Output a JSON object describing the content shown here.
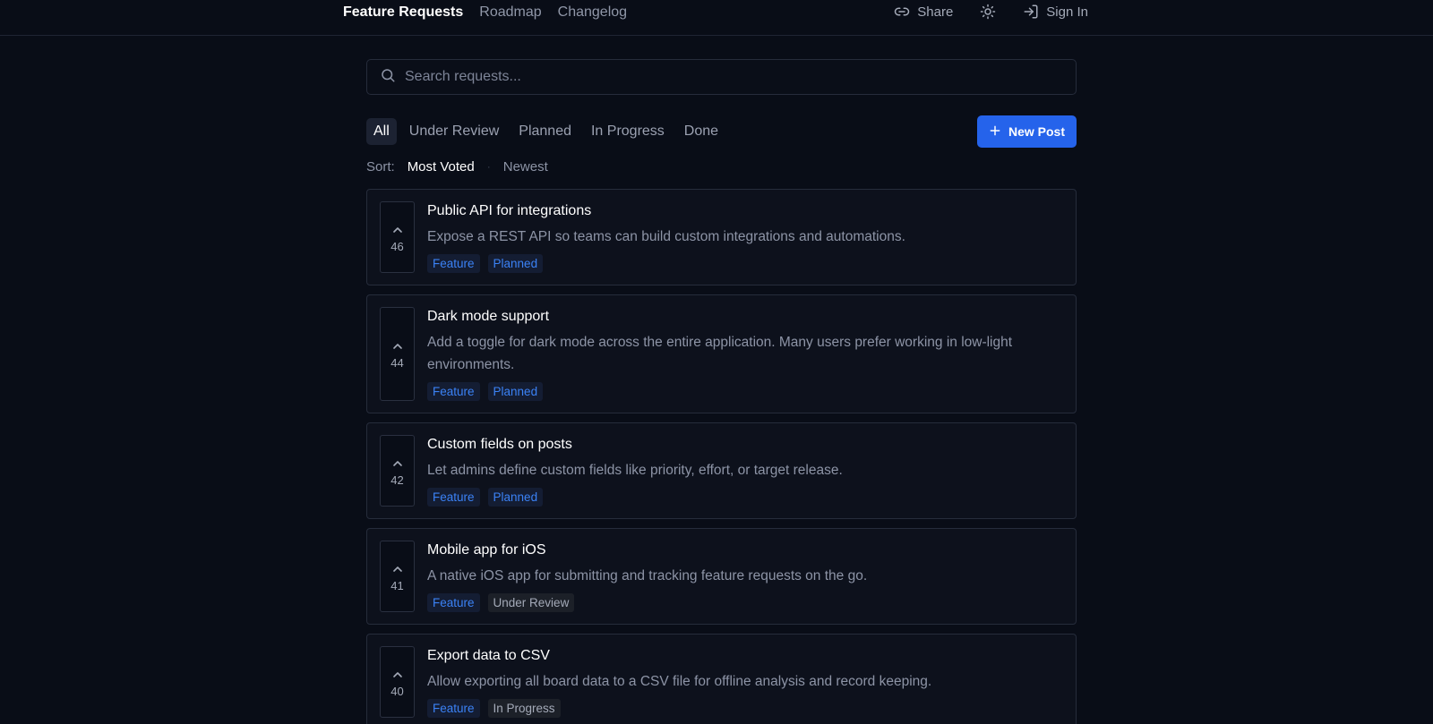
{
  "nav": {
    "links": [
      "Feature Requests",
      "Roadmap",
      "Changelog"
    ],
    "share_label": "Share",
    "signin_label": "Sign In"
  },
  "search": {
    "placeholder": "Search requests..."
  },
  "filters": [
    "All",
    "Under Review",
    "Planned",
    "In Progress",
    "Done"
  ],
  "new_post_label": "New Post",
  "sort": {
    "label": "Sort:",
    "options": [
      "Most Voted",
      "Newest"
    ],
    "separator": "·"
  },
  "posts": [
    {
      "title": "Public API for integrations",
      "description": "Expose a REST API so teams can build custom integrations and automations.",
      "votes": "46",
      "tags": [
        "Feature",
        "Planned"
      ]
    },
    {
      "title": "Dark mode support",
      "description": "Add a toggle for dark mode across the entire application. Many users prefer working in low-light environments.",
      "votes": "44",
      "tags": [
        "Feature",
        "Planned"
      ]
    },
    {
      "title": "Custom fields on posts",
      "description": "Let admins define custom fields like priority, effort, or target release.",
      "votes": "42",
      "tags": [
        "Feature",
        "Planned"
      ]
    },
    {
      "title": "Mobile app for iOS",
      "description": "A native iOS app for submitting and tracking feature requests on the go.",
      "votes": "41",
      "tags": [
        "Feature",
        "Under Review"
      ]
    },
    {
      "title": "Export data to CSV",
      "description": "Allow exporting all board data to a CSV file for offline analysis and record keeping.",
      "votes": "40",
      "tags": [
        "Feature",
        "In Progress"
      ]
    }
  ],
  "colors": {
    "accent": "#2563eb",
    "background": "#090d17",
    "tag_blue": "#3b82f6"
  },
  "icons": {
    "share": "link-icon",
    "theme": "sun-icon",
    "signin": "sign-in-icon",
    "search": "search-icon",
    "add": "plus-icon",
    "upvote": "chevron-up-icon"
  }
}
